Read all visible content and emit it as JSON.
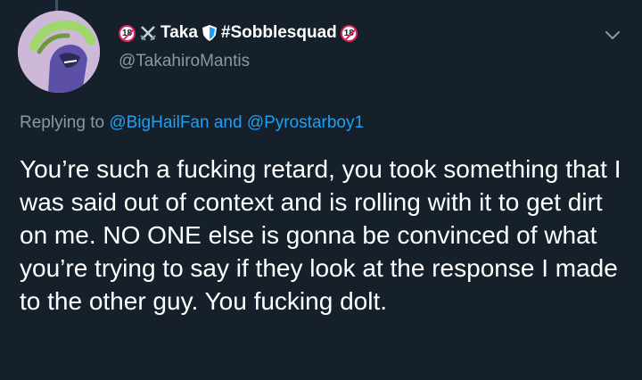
{
  "tweet": {
    "display_name": {
      "prefix_badge": "18",
      "name": "Taka",
      "hashtag": "#Sobblesquad",
      "suffix_badge": "18"
    },
    "handle": "@TakahiroMantis",
    "replying": {
      "prefix": "Replying to",
      "mention1": "@BigHailFan",
      "conjunction": "and",
      "mention2": "@Pyrostarboy1"
    },
    "text": "You’re such a fucking retard, you took something that I was said out of context and is rolling with it to get dirt on me. NO ONE else is gonna be convinced of what you’re trying to say if they look at the response I made to the other guy. You fucking dolt."
  }
}
